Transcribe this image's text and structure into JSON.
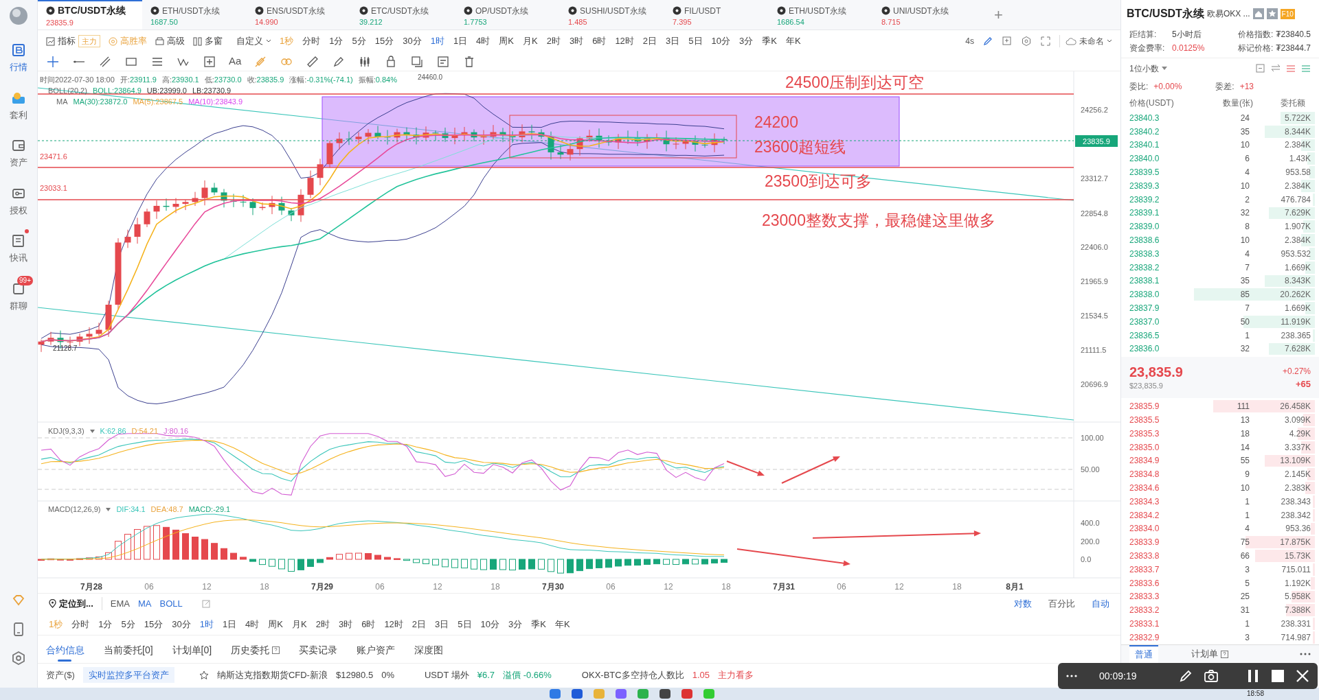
{
  "sidebar": {
    "items": [
      {
        "label": "行情",
        "selected": true,
        "notification_dot": false
      },
      {
        "label": "套利",
        "selected": false,
        "notification_dot": false
      },
      {
        "label": "资产",
        "selected": false,
        "notification_dot": false
      },
      {
        "label": "授权",
        "selected": false,
        "notification_dot": false
      },
      {
        "label": "快讯",
        "selected": false,
        "notification_dot": true
      },
      {
        "label": "群聊",
        "selected": false,
        "notification_dot": false,
        "badge": "99+"
      }
    ]
  },
  "tabs": [
    {
      "symbol": "BTC/USDT永续",
      "price": "23835.9",
      "up": false,
      "selected": true
    },
    {
      "symbol": "ETH/USDT永续",
      "price": "1687.50",
      "up": true,
      "selected": false
    },
    {
      "symbol": "ENS/USDT永续",
      "price": "14.990",
      "up": false,
      "selected": false
    },
    {
      "symbol": "ETC/USDT永续",
      "price": "39.212",
      "up": true,
      "selected": false
    },
    {
      "symbol": "OP/USDT永续",
      "price": "1.7753",
      "up": true,
      "selected": false
    },
    {
      "symbol": "SUSHI/USDT永续",
      "price": "1.485",
      "up": false,
      "selected": false
    },
    {
      "symbol": "FIL/USDT",
      "price": "7.395",
      "up": false,
      "selected": false
    },
    {
      "symbol": "ETH/USDT永续",
      "price": "1686.54",
      "up": true,
      "selected": false
    },
    {
      "symbol": "UNI/USDT永续",
      "price": "8.715",
      "up": false,
      "selected": false
    }
  ],
  "add_tab": "+",
  "toolbar": {
    "indicator": "指标",
    "indicator_badge": "主力",
    "win_rate": "高胜率",
    "advanced": "高级",
    "multi_window": "多窗",
    "custom": "自定义",
    "refresh": "4s",
    "layout_name": "未命名",
    "intervals": [
      {
        "label": "1秒",
        "accent": true,
        "selected": false
      },
      {
        "label": "分时",
        "accent": false,
        "selected": false
      },
      {
        "label": "1分",
        "accent": false,
        "selected": false
      },
      {
        "label": "5分",
        "accent": false,
        "selected": false
      },
      {
        "label": "15分",
        "accent": false,
        "selected": false
      },
      {
        "label": "30分",
        "accent": false,
        "selected": false
      },
      {
        "label": "1时",
        "accent": false,
        "selected": true
      },
      {
        "label": "1日",
        "accent": false,
        "selected": false
      },
      {
        "label": "4时",
        "accent": false,
        "selected": false
      },
      {
        "label": "周K",
        "accent": false,
        "selected": false
      },
      {
        "label": "月K",
        "accent": false,
        "selected": false
      },
      {
        "label": "2时",
        "accent": false,
        "selected": false
      },
      {
        "label": "3时",
        "accent": false,
        "selected": false
      },
      {
        "label": "6时",
        "accent": false,
        "selected": false
      },
      {
        "label": "12时",
        "accent": false,
        "selected": false
      },
      {
        "label": "2日",
        "accent": false,
        "selected": false
      },
      {
        "label": "3日",
        "accent": false,
        "selected": false
      },
      {
        "label": "5日",
        "accent": false,
        "selected": false
      },
      {
        "label": "10分",
        "accent": false,
        "selected": false
      },
      {
        "label": "3分",
        "accent": false,
        "selected": false
      },
      {
        "label": "季K",
        "accent": false,
        "selected": false
      },
      {
        "label": "年K",
        "accent": false,
        "selected": false
      }
    ]
  },
  "drawing_tools": {
    "text_tool": "Aa"
  },
  "chart": {
    "info": {
      "time": "时间2022-07-30 18:00",
      "fields": [
        {
          "label": "开:",
          "value": "23911.9"
        },
        {
          "label": "高:",
          "value": "23930.1"
        },
        {
          "label": "低:",
          "value": "23730.0"
        },
        {
          "label": "收:",
          "value": "23835.9"
        },
        {
          "label": "涨幅:",
          "value": "-0.31%(-74.1)"
        },
        {
          "label": "振幅:",
          "value": "0.84%"
        }
      ]
    },
    "boll": {
      "name": "BOLL(20,2)",
      "values": [
        "BOLL:23864.9",
        "UB:23999.0",
        "LB:23730.9"
      ]
    },
    "ma": {
      "name": "MA",
      "values": [
        "MA(30):23872.0",
        "MA(5):23867.5",
        "MA(10):23843.9"
      ]
    },
    "price_axis": [
      "24256.2",
      "23312.7",
      "22854.8",
      "22406.0",
      "21965.9",
      "21534.5",
      "21111.5",
      "20696.9"
    ],
    "current_price": "23835.9",
    "high_label": "24460.0",
    "low_label": "21128.7",
    "line_labels": [
      "23471.6",
      "23033.1"
    ],
    "annotations": [
      "24500压制到达可空",
      "24200",
      "23600超短线",
      "23500到达可多",
      "23000整数支撑，最稳健这里做多"
    ],
    "kdj": {
      "name": "KDJ(9,3,3)",
      "values": [
        "K:62.86",
        "D:54.21",
        "J:80.16"
      ],
      "axis": [
        "100.00",
        "50.00"
      ]
    },
    "macd": {
      "name": "MACD(12,26,9)",
      "values": [
        "DIF:34.1",
        "DEA:48.7",
        "MACD:-29.1"
      ],
      "axis": [
        "400.0",
        "200.0",
        "0.0"
      ]
    },
    "time_axis": [
      {
        "label": "7月28",
        "bold": true
      },
      {
        "label": "06",
        "bold": false
      },
      {
        "label": "12",
        "bold": false
      },
      {
        "label": "18",
        "bold": false
      },
      {
        "label": "7月29",
        "bold": true
      },
      {
        "label": "06",
        "bold": false
      },
      {
        "label": "12",
        "bold": false
      },
      {
        "label": "18",
        "bold": false
      },
      {
        "label": "7月30",
        "bold": true
      },
      {
        "label": "06",
        "bold": false
      },
      {
        "label": "12",
        "bold": false
      },
      {
        "label": "18",
        "bold": false
      },
      {
        "label": "7月31",
        "bold": true
      },
      {
        "label": "06",
        "bold": false
      },
      {
        "label": "12",
        "bold": false
      },
      {
        "label": "18",
        "bold": false
      },
      {
        "label": "8月1",
        "bold": true
      }
    ]
  },
  "chart_footer": {
    "locate": "定位到...",
    "intervals": [
      {
        "label": "1秒",
        "accent": true,
        "selected": false
      },
      {
        "label": "分时",
        "accent": false,
        "selected": false
      },
      {
        "label": "1分",
        "accent": false,
        "selected": false
      },
      {
        "label": "5分",
        "accent": false,
        "selected": false
      },
      {
        "label": "15分",
        "accent": false,
        "selected": false
      },
      {
        "label": "30分",
        "accent": false,
        "selected": false
      },
      {
        "label": "1时",
        "accent": false,
        "selected": true
      },
      {
        "label": "1日",
        "accent": false,
        "selected": false
      },
      {
        "label": "4时",
        "accent": false,
        "selected": false
      },
      {
        "label": "周K",
        "accent": false,
        "selected": false
      },
      {
        "label": "月K",
        "accent": false,
        "selected": false
      },
      {
        "label": "2时",
        "accent": false,
        "selected": false
      },
      {
        "label": "3时",
        "accent": false,
        "selected": false
      },
      {
        "label": "6时",
        "accent": false,
        "selected": false
      },
      {
        "label": "12时",
        "accent": false,
        "selected": false
      },
      {
        "label": "2日",
        "accent": false,
        "selected": false
      },
      {
        "label": "3日",
        "accent": false,
        "selected": false
      },
      {
        "label": "5日",
        "accent": false,
        "selected": false
      },
      {
        "label": "10分",
        "accent": false,
        "selected": false
      },
      {
        "label": "3分",
        "accent": false,
        "selected": false
      },
      {
        "label": "季K",
        "accent": false,
        "selected": false
      },
      {
        "label": "年K",
        "accent": false,
        "selected": false
      }
    ],
    "indicators": [
      {
        "label": "EMA",
        "on": false
      },
      {
        "label": "MA",
        "on": true
      },
      {
        "label": "BOLL",
        "on": true
      }
    ],
    "scales": [
      {
        "label": "对数",
        "on": true
      },
      {
        "label": "百分比",
        "on": false
      },
      {
        "label": "自动",
        "on": true
      }
    ]
  },
  "bottom_tabs": [
    {
      "label": "合约信息",
      "selected": true
    },
    {
      "label": "当前委托[0]",
      "selected": false
    },
    {
      "label": "计划单[0]",
      "selected": false
    },
    {
      "label": "历史委托",
      "selected": false
    },
    {
      "label": "买卖记录",
      "selected": false
    },
    {
      "label": "账户资产",
      "selected": false
    },
    {
      "label": "深度图",
      "selected": false
    }
  ],
  "ticker": {
    "assets": "资产($)",
    "monitor": "实时监控多平台资产",
    "index_name": "纳斯达克指数期货CFD-新浪",
    "index_price": "$12980.5",
    "index_change": "0%",
    "otc_label": "USDT 場外",
    "otc_price": "¥6.7",
    "premium": "溢價 -0.66%",
    "ratio_label": "OKX-BTC多空持仓人数比",
    "ratio_value": "1.05",
    "ratio_note": "主力看多"
  },
  "right_panel": {
    "title": "BTC/USDT永续",
    "exchange": "欧易OKX ...",
    "badge": "F10",
    "settle_label": "距结算:",
    "settle_value": "5小时后",
    "index_label": "价格指数:",
    "index_value": "₮23840.5",
    "funding_label": "资金费率:",
    "funding_value": "0.0125%",
    "mark_label": "标记价格:",
    "mark_value": "₮23844.7",
    "precision": "1位小数",
    "ratio_label": "委比:",
    "ratio_value": "+0.00%",
    "diff_label": "委差:",
    "diff_value": "+13",
    "columns": [
      "价格(USDT)",
      "数量(张)",
      "委托额"
    ],
    "asks": [
      {
        "price": "23840.3",
        "qty": "24",
        "amount": "5.722K",
        "level": 0.18
      },
      {
        "price": "23840.2",
        "qty": "35",
        "amount": "8.344K",
        "level": 0.26
      },
      {
        "price": "23840.1",
        "qty": "10",
        "amount": "2.384K",
        "level": 0.07
      },
      {
        "price": "23840.0",
        "qty": "6",
        "amount": "1.43K",
        "level": 0.04
      },
      {
        "price": "23839.5",
        "qty": "4",
        "amount": "953.58",
        "level": 0.03
      },
      {
        "price": "23839.3",
        "qty": "10",
        "amount": "2.384K",
        "level": 0.07
      },
      {
        "price": "23839.2",
        "qty": "2",
        "amount": "476.784",
        "level": 0.01
      },
      {
        "price": "23839.1",
        "qty": "32",
        "amount": "7.629K",
        "level": 0.24
      },
      {
        "price": "23839.0",
        "qty": "8",
        "amount": "1.907K",
        "level": 0.06
      },
      {
        "price": "23838.6",
        "qty": "10",
        "amount": "2.384K",
        "level": 0.07
      },
      {
        "price": "23838.3",
        "qty": "4",
        "amount": "953.532",
        "level": 0.03
      },
      {
        "price": "23838.2",
        "qty": "7",
        "amount": "1.669K",
        "level": 0.05
      },
      {
        "price": "23838.1",
        "qty": "35",
        "amount": "8.343K",
        "level": 0.26
      },
      {
        "price": "23838.0",
        "qty": "85",
        "amount": "20.262K",
        "level": 0.63
      },
      {
        "price": "23837.9",
        "qty": "7",
        "amount": "1.669K",
        "level": 0.05
      },
      {
        "price": "23837.0",
        "qty": "50",
        "amount": "11.919K",
        "level": 0.37
      },
      {
        "price": "23836.5",
        "qty": "1",
        "amount": "238.365",
        "level": 0.01
      },
      {
        "price": "23836.0",
        "qty": "32",
        "amount": "7.628K",
        "level": 0.24
      }
    ],
    "last_price": "23,835.9",
    "last_usd": "$23,835.9",
    "change_pct": "+0.27%",
    "change_abs": "+65",
    "bids": [
      {
        "price": "23835.9",
        "qty": "111",
        "amount": "26.458K",
        "level": 0.53
      },
      {
        "price": "23835.5",
        "qty": "13",
        "amount": "3.099K",
        "level": 0.06
      },
      {
        "price": "23835.3",
        "qty": "18",
        "amount": "4.29K",
        "level": 0.09
      },
      {
        "price": "23835.0",
        "qty": "14",
        "amount": "3.337K",
        "level": 0.07
      },
      {
        "price": "23834.9",
        "qty": "55",
        "amount": "13.109K",
        "level": 0.26
      },
      {
        "price": "23834.8",
        "qty": "9",
        "amount": "2.145K",
        "level": 0.04
      },
      {
        "price": "23834.6",
        "qty": "10",
        "amount": "2.383K",
        "level": 0.05
      },
      {
        "price": "23834.3",
        "qty": "1",
        "amount": "238.343",
        "level": 0.01
      },
      {
        "price": "23834.2",
        "qty": "1",
        "amount": "238.342",
        "level": 0.01
      },
      {
        "price": "23834.0",
        "qty": "4",
        "amount": "953.36",
        "level": 0.02
      },
      {
        "price": "23833.9",
        "qty": "75",
        "amount": "17.875K",
        "level": 0.36
      },
      {
        "price": "23833.8",
        "qty": "66",
        "amount": "15.73K",
        "level": 0.31
      },
      {
        "price": "23833.7",
        "qty": "3",
        "amount": "715.011",
        "level": 0.01
      },
      {
        "price": "23833.6",
        "qty": "5",
        "amount": "1.192K",
        "level": 0.02
      },
      {
        "price": "23833.3",
        "qty": "25",
        "amount": "5.958K",
        "level": 0.12
      },
      {
        "price": "23833.2",
        "qty": "31",
        "amount": "7.388K",
        "level": 0.15
      },
      {
        "price": "23833.1",
        "qty": "1",
        "amount": "238.331",
        "level": 0.01
      },
      {
        "price": "23832.9",
        "qty": "3",
        "amount": "714.987",
        "level": 0.01
      }
    ],
    "order_tabs": [
      {
        "label": "普通",
        "selected": true
      },
      {
        "label": "计划单",
        "selected": false
      }
    ]
  },
  "recorder": {
    "elapsed": "00:09:19"
  },
  "taskbar": {
    "time": "18:58"
  }
}
